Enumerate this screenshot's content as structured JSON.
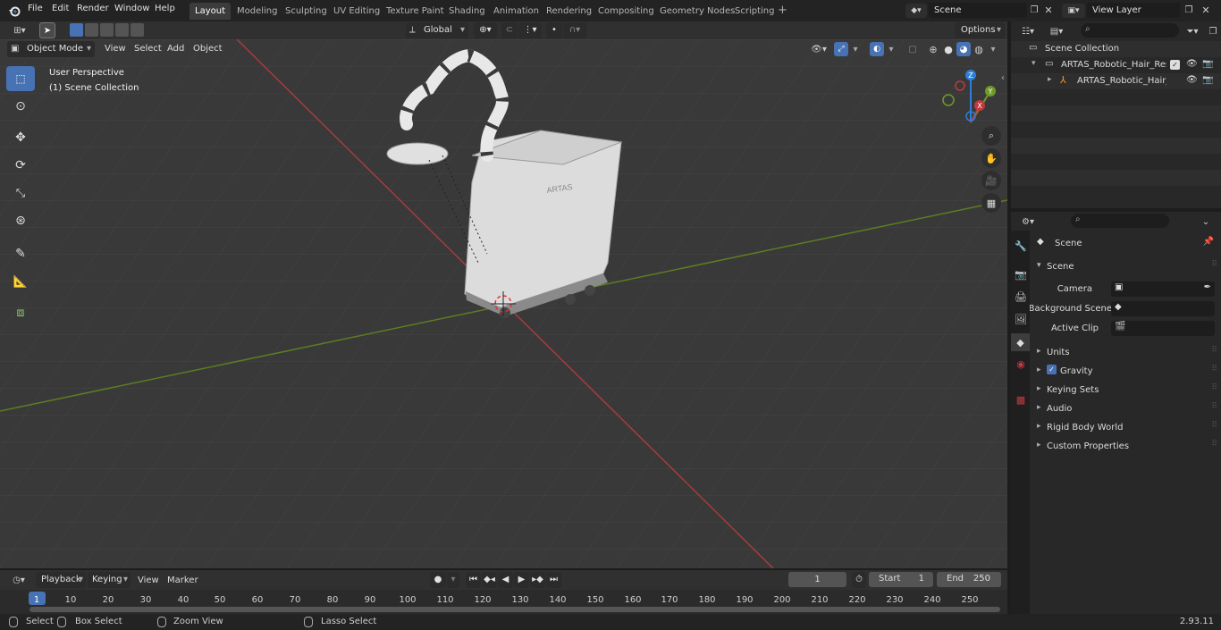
{
  "menu": [
    "File",
    "Edit",
    "Render",
    "Window",
    "Help"
  ],
  "workspaces": [
    "Layout",
    "Modeling",
    "Sculpting",
    "UV Editing",
    "Texture Paint",
    "Shading",
    "Animation",
    "Rendering",
    "Compositing",
    "Geometry Nodes",
    "Scripting"
  ],
  "active_workspace": "Layout",
  "scene_name": "Scene",
  "view_layer": "View Layer",
  "viewport": {
    "mode": "Object Mode",
    "menus": [
      "View",
      "Select",
      "Add",
      "Object"
    ],
    "transform_orientation": "Global",
    "options_label": "Options",
    "overlay_title": "User Perspective",
    "overlay_subtitle": "(1) Scene Collection",
    "model_label": "ARTAS"
  },
  "gizmo": {
    "z": "Z",
    "y": "Y",
    "x": "X"
  },
  "outliner": {
    "root": "Scene Collection",
    "items": [
      "ARTAS_Robotic_Hair_Restora",
      "ARTAS_Robotic_Hair_Res"
    ]
  },
  "properties": {
    "header": "Scene",
    "panel": "Scene",
    "fields": [
      {
        "label": "Camera",
        "value": ""
      },
      {
        "label": "Background Scene",
        "value": ""
      },
      {
        "label": "Active Clip",
        "value": ""
      }
    ],
    "sections": [
      "Units",
      "Gravity",
      "Keying Sets",
      "Audio",
      "Rigid Body World",
      "Custom Properties"
    ]
  },
  "timeline": {
    "menus": [
      "Playback",
      "Keying",
      "View",
      "Marker"
    ],
    "current_frame": "1",
    "start_label": "Start",
    "start": "1",
    "end_label": "End",
    "end": "250",
    "ruler": [
      "1",
      "10",
      "20",
      "30",
      "40",
      "50",
      "60",
      "70",
      "80",
      "90",
      "100",
      "110",
      "120",
      "130",
      "140",
      "150",
      "160",
      "170",
      "180",
      "190",
      "200",
      "210",
      "220",
      "230",
      "240",
      "250"
    ]
  },
  "statusbar": {
    "items": [
      "Select",
      "Box Select",
      "Zoom View",
      "Lasso Select"
    ],
    "version": "2.93.11"
  },
  "colors": {
    "accent": "#4772b3",
    "x_axis": "#c0393d",
    "y_axis": "#6f9a2a",
    "z_axis": "#2f7fd6"
  }
}
